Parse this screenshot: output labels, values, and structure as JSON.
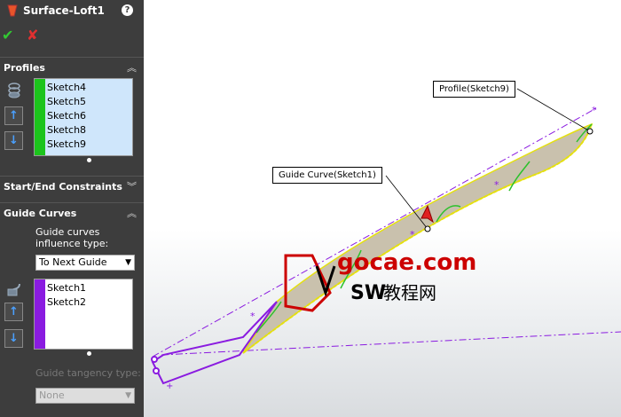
{
  "panel": {
    "title": "Surface-Loft1",
    "help_label": "?",
    "ok_label": "✔",
    "cancel_label": "✘",
    "profiles": {
      "header": "Profiles",
      "items": [
        "Sketch4",
        "Sketch5",
        "Sketch6",
        "Sketch8",
        "Sketch9"
      ],
      "bar_color": "#1cc41c",
      "list_bg": "#cfe6fb"
    },
    "start_end": {
      "header": "Start/End Constraints"
    },
    "guide_curves": {
      "header": "Guide Curves",
      "influence_label": "Guide curves influence type:",
      "influence_value": "To Next Guide",
      "items": [
        "Sketch1",
        "Sketch2"
      ],
      "bar_color": "#8a1be0",
      "tangency_label": "Guide tangency type:",
      "tangency_value": "None"
    }
  },
  "viewport": {
    "callout_profile": "Profile(Sketch9)",
    "callout_guide": "Guide Curve(Sketch1)",
    "watermark_url": "gocae.com",
    "watermark_sub_latin": "SW",
    "watermark_sub_cjk": "教程网"
  }
}
